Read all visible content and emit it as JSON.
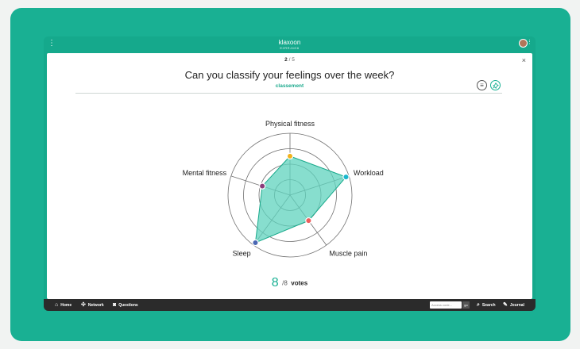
{
  "header": {
    "brand": "klaxoon",
    "session_code": "E2RRJ4G6",
    "menu_icon": "kebab-icon",
    "avatar_icon": "user-avatar"
  },
  "question": {
    "counter_current": "2",
    "counter_separator": "/",
    "counter_total": "5",
    "text": "Can you classify your feelings over the week?",
    "type_label": "classement",
    "close_symbol": "×"
  },
  "votes": {
    "count": "8",
    "total": "/8",
    "label": "votes"
  },
  "chart_data": {
    "type": "radar",
    "axes": [
      "Physical fitness",
      "Workload",
      "Muscle pain",
      "Sleep",
      "Mental fitness"
    ],
    "values": [
      0.63,
      0.95,
      0.51,
      0.95,
      0.47
    ],
    "range": [
      0,
      1
    ],
    "rings": 4,
    "point_colors": [
      "#f2b21c",
      "#1ab6cc",
      "#ee5d5d",
      "#4a67b3",
      "#8a3a7a"
    ],
    "fill_color": "#5fd3bd",
    "stroke_color": "#18a98b"
  },
  "bottombar": {
    "home": "Home",
    "network": "Network",
    "questions": "Questions",
    "search_placeholder": "Access code...",
    "go": "go",
    "search": "Search",
    "journal": "Journal"
  },
  "colors": {
    "brand": "#19b093",
    "bar": "#2b2b2b"
  }
}
